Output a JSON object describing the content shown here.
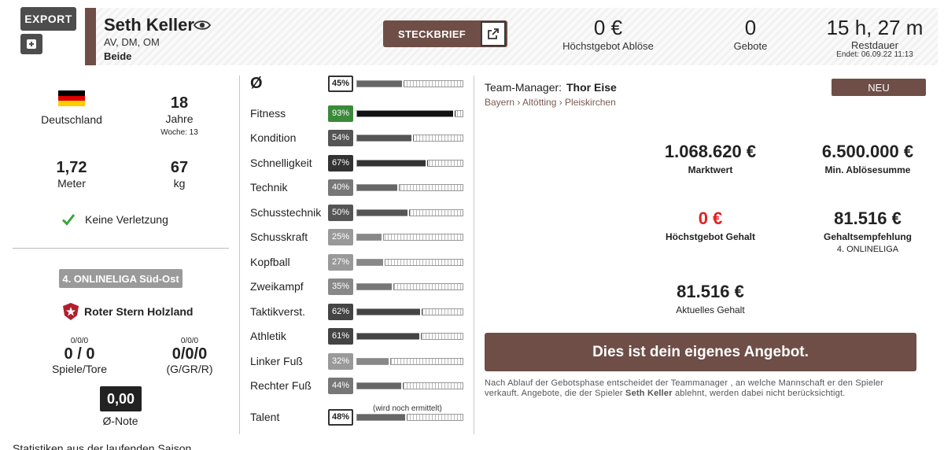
{
  "header": {
    "export_label": "EXPORT",
    "player_name": "Seth Keller",
    "positions": "AV, DM, OM",
    "foot": "Beide",
    "steckbrief_label": "STECKBRIEF",
    "highest_bid_value": "0 €",
    "highest_bid_label": "Höchstgebot Ablöse",
    "bids_value": "0",
    "bids_label": "Gebote",
    "time_value": "15 h, 27 m",
    "time_label": "Restdauer",
    "end_label": "Endet: 06.09.22 11:13"
  },
  "profile": {
    "nation": "Deutschland",
    "age_value": "18",
    "age_unit": "Jahre",
    "age_week": "Woche: 13",
    "height_value": "1,72",
    "height_unit": "Meter",
    "weight_value": "67",
    "weight_unit": "kg",
    "injury_status": "Keine Verletzung",
    "flag_colors": [
      "#000000",
      "#dd0000",
      "#ffce00"
    ]
  },
  "club": {
    "league": "4. ONLINELIGA Süd-Ost",
    "name": "Roter Stern Holzland",
    "games_small": "0/0/0",
    "games_value": "0 / 0",
    "games_label": "Spiele/Tore",
    "cards_small": "0/0/0",
    "cards_value": "0/0/0",
    "cards_label": "(G/GR/R)",
    "avg_note_value": "0,00",
    "avg_note_label": "Ø-Note"
  },
  "skills": {
    "average": {
      "label": "Ø",
      "percent": 45,
      "pct_text": "45%"
    },
    "items": [
      {
        "label": "Fitness",
        "percent": 93,
        "pct_text": "93%",
        "color": "#3a8a3a",
        "fill": "#111111"
      },
      {
        "label": "Kondition",
        "percent": 54,
        "pct_text": "54%",
        "color": "#555555",
        "fill": "#555555"
      },
      {
        "label": "Schnelligkeit",
        "percent": 67,
        "pct_text": "67%",
        "color": "#333333",
        "fill": "#333333"
      },
      {
        "label": "Technik",
        "percent": 40,
        "pct_text": "40%",
        "color": "#777777",
        "fill": "#666666"
      },
      {
        "label": "Schusstechnik",
        "percent": 50,
        "pct_text": "50%",
        "color": "#555555",
        "fill": "#555555"
      },
      {
        "label": "Schusskraft",
        "percent": 25,
        "pct_text": "25%",
        "color": "#999999",
        "fill": "#888888"
      },
      {
        "label": "Kopfball",
        "percent": 27,
        "pct_text": "27%",
        "color": "#999999",
        "fill": "#888888"
      },
      {
        "label": "Zweikampf",
        "percent": 35,
        "pct_text": "35%",
        "color": "#888888",
        "fill": "#777777"
      },
      {
        "label": "Taktikverst.",
        "percent": 62,
        "pct_text": "62%",
        "color": "#444444",
        "fill": "#444444"
      },
      {
        "label": "Athletik",
        "percent": 61,
        "pct_text": "61%",
        "color": "#444444",
        "fill": "#444444"
      },
      {
        "label": "Linker Fuß",
        "percent": 32,
        "pct_text": "32%",
        "color": "#999999",
        "fill": "#888888"
      },
      {
        "label": "Rechter Fuß",
        "percent": 44,
        "pct_text": "44%",
        "color": "#777777",
        "fill": "#666666"
      }
    ],
    "talent": {
      "label": "Talent",
      "percent": 48,
      "pct_text": "48%",
      "note": "(wird noch ermittelt)"
    }
  },
  "offer": {
    "manager_label": "Team-Manager:",
    "manager_name": "Thor Eise",
    "breadcrumb": "Bayern › Altötting › Pleiskirchen",
    "status_badge": "NEU",
    "market_value": "1.068.620 €",
    "market_value_label": "Marktwert",
    "min_fee": "6.500.000 €",
    "min_fee_label": "Min. Ablösesumme",
    "highest_salary_bid": "0 €",
    "highest_salary_bid_label": "Höchstgebot Gehalt",
    "salary_recommendation": "81.516 €",
    "salary_recommendation_label": "Gehaltsempfehlung",
    "salary_recommendation_sub": "4. ONLINELIGA",
    "current_salary": "81.516 €",
    "current_salary_label": "Aktuelles Gehalt",
    "own_offer_label": "Dies ist dein eigenes Angebot.",
    "footnote_a": "Nach Ablauf der Gebotsphase entscheidet der Teammanager , an welche Mannschaft er den Spieler verkauft. Angebote, die der Spieler",
    "footnote_name": "Seth Keller",
    "footnote_b": "ablehnt, werden dabei nicht berücksichtigt.",
    "accent_color": "#6e4e47",
    "red_color": "#e02020"
  },
  "footer": {
    "statistics_text": "Statistiken aus der laufenden Saison"
  }
}
